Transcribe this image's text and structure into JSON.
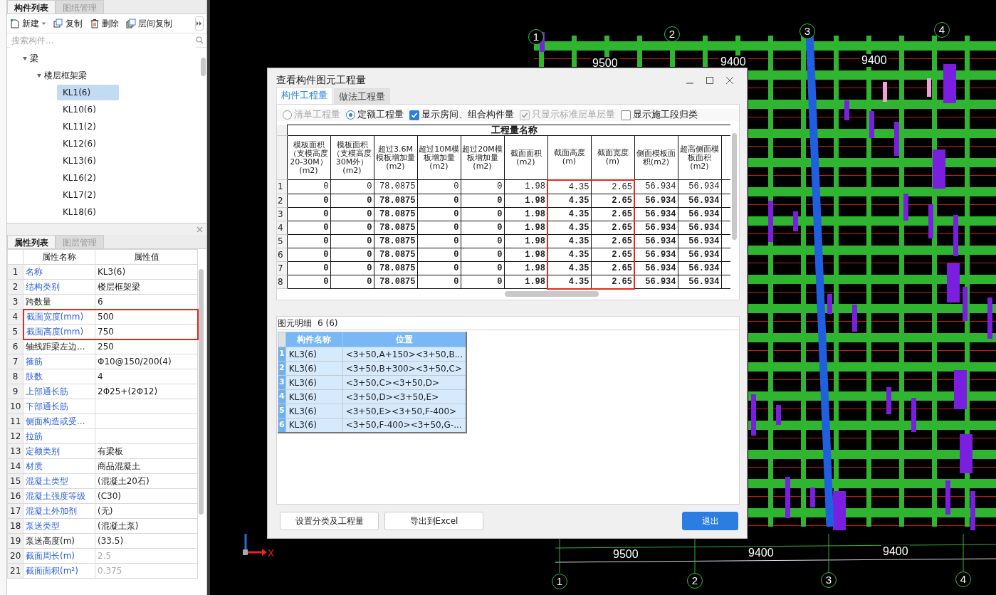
{
  "left_panel": {
    "tabs": [
      {
        "label": "构件列表",
        "selected": true
      },
      {
        "label": "图纸管理",
        "selected": false
      }
    ],
    "toolbar": [
      {
        "kind": "new",
        "label": "新建",
        "has_menu": true
      },
      {
        "kind": "copy",
        "label": "复制",
        "has_menu": false
      },
      {
        "kind": "delete",
        "label": "删除",
        "has_menu": false
      },
      {
        "kind": "floor_copy",
        "label": "层间复制",
        "has_menu": false
      }
    ],
    "search": {
      "placeholder": "搜索构件..."
    },
    "tree": [
      {
        "label": "梁",
        "expanded": true,
        "children": [
          {
            "label": "楼层框架梁",
            "expanded": true,
            "children": [
              {
                "label": "KL1(6)",
                "selected": true
              },
              {
                "label": "KL10(6)",
                "selected": false
              },
              {
                "label": "KL11(2)",
                "selected": false
              },
              {
                "label": "KL12(6)",
                "selected": false
              },
              {
                "label": "KL13(6)",
                "selected": false
              },
              {
                "label": "KL16(2)",
                "selected": false
              },
              {
                "label": "KL17(2)",
                "selected": false
              },
              {
                "label": "KL18(6)",
                "selected": false
              }
            ]
          }
        ]
      }
    ]
  },
  "properties": {
    "tabs": [
      {
        "label": "属性列表",
        "selected": true
      },
      {
        "label": "图层管理",
        "selected": false
      }
    ],
    "columns": [
      "属性名称",
      "属性值"
    ],
    "rows": [
      {
        "number": "1",
        "name": "名称",
        "value": "KL3(6)",
        "linked": true,
        "greyed": false,
        "highlighted": false
      },
      {
        "number": "2",
        "name": "结构类别",
        "value": "楼层框架梁",
        "linked": true,
        "greyed": false,
        "highlighted": false
      },
      {
        "number": "3",
        "name": "跨数量",
        "value": "6",
        "linked": false,
        "greyed": false,
        "highlighted": false
      },
      {
        "number": "4",
        "name": "截面宽度(mm)",
        "value": "500",
        "linked": true,
        "greyed": false,
        "highlighted": true
      },
      {
        "number": "5",
        "name": "截面高度(mm)",
        "value": "750",
        "linked": true,
        "greyed": false,
        "highlighted": true
      },
      {
        "number": "6",
        "name": "轴线距梁左边...",
        "value": "250",
        "linked": false,
        "greyed": false,
        "highlighted": false
      },
      {
        "number": "7",
        "name": "箍筋",
        "value": "Φ10@150/200(4)",
        "linked": true,
        "greyed": false,
        "highlighted": false
      },
      {
        "number": "8",
        "name": "肢数",
        "value": "4",
        "linked": true,
        "greyed": false,
        "highlighted": false
      },
      {
        "number": "9",
        "name": "上部通长筋",
        "value": "2Φ25+(2Φ12)",
        "linked": true,
        "greyed": false,
        "highlighted": false
      },
      {
        "number": "10",
        "name": "下部通长筋",
        "linked": true,
        "greyed": false,
        "highlighted": false
      },
      {
        "number": "11",
        "name": "侧面构造或受...",
        "linked": true,
        "greyed": false,
        "highlighted": false
      },
      {
        "number": "12",
        "name": "拉筋",
        "linked": true,
        "greyed": false,
        "highlighted": false
      },
      {
        "number": "13",
        "name": "定额类别",
        "value": "有梁板",
        "linked": true,
        "greyed": false,
        "highlighted": false
      },
      {
        "number": "14",
        "name": "材质",
        "value": "商品混凝土",
        "linked": true,
        "greyed": false,
        "highlighted": false
      },
      {
        "number": "15",
        "name": "混凝土类型",
        "value": "(混凝土20石)",
        "linked": true,
        "greyed": false,
        "highlighted": false
      },
      {
        "number": "16",
        "name": "混凝土强度等级",
        "value": "(C30)",
        "linked": true,
        "greyed": false,
        "highlighted": false
      },
      {
        "number": "17",
        "name": "混凝土外加剂",
        "value": "(无)",
        "linked": true,
        "greyed": false,
        "highlighted": false
      },
      {
        "number": "18",
        "name": "泵送类型",
        "value": "(混凝土泵)",
        "linked": true,
        "greyed": false,
        "highlighted": false
      },
      {
        "number": "19",
        "name": "泵送高度(m)",
        "value": "(33.5)",
        "linked": false,
        "greyed": false,
        "highlighted": false
      },
      {
        "number": "20",
        "name": "截面周长(m)",
        "value": "2.5",
        "linked": true,
        "greyed": true,
        "highlighted": false
      },
      {
        "number": "21",
        "name": "截面面积(m²)",
        "value": "0.375",
        "linked": true,
        "greyed": true,
        "highlighted": false
      }
    ]
  },
  "dialog": {
    "title": "查看构件图元工程量",
    "tabs": [
      {
        "label": "构件工程量",
        "selected": true
      },
      {
        "label": "做法工程量",
        "selected": false
      }
    ],
    "options": [
      {
        "kind": "radio",
        "label": "清单工程量",
        "checked": false,
        "disabled": true
      },
      {
        "kind": "radio",
        "label": "定额工程量",
        "checked": true,
        "disabled": false
      },
      {
        "kind": "checkbox",
        "label": "显示房间、组合构件量",
        "checked": true,
        "disabled": false
      },
      {
        "kind": "checkbox",
        "label": "只显示标准层单层量",
        "checked": true,
        "disabled": true
      },
      {
        "kind": "checkbox",
        "label": "显示施工段归类",
        "checked": false,
        "disabled": false
      }
    ],
    "table": {
      "group_header": "工程量名称",
      "columns": [
        {
          "label": "模板面积（支模高度20-30M）(m2)",
          "highlighted": false
        },
        {
          "label": "模板面积（支模高度30M外）(m2)",
          "highlighted": false
        },
        {
          "label": "超过3.6M模板增加量(m2)",
          "highlighted": false
        },
        {
          "label": "超过10M模板增加量(m2)",
          "highlighted": false
        },
        {
          "label": "超过20M模板增加量(m2)",
          "highlighted": false
        },
        {
          "label": "截面面积(m2)",
          "highlighted": false
        },
        {
          "label": "截面高度(m)",
          "highlighted": true
        },
        {
          "label": "截面宽度(m)",
          "highlighted": true
        },
        {
          "label": "侧面模板面积(m2)",
          "highlighted": false
        },
        {
          "label": "超高侧面模板面积(m2)",
          "highlighted": false
        }
      ],
      "rows": [
        {
          "number": "1",
          "bold": false,
          "cells": [
            "0",
            "0",
            "78.0875",
            "0",
            "0",
            "1.98",
            "4.35",
            "2.65",
            "56.934",
            "56.934"
          ]
        },
        {
          "number": "2",
          "bold": true,
          "cells": [
            "0",
            "0",
            "78.0875",
            "0",
            "0",
            "1.98",
            "4.35",
            "2.65",
            "56.934",
            "56.934"
          ]
        },
        {
          "number": "3",
          "bold": true,
          "cells": [
            "0",
            "0",
            "78.0875",
            "0",
            "0",
            "1.98",
            "4.35",
            "2.65",
            "56.934",
            "56.934"
          ]
        },
        {
          "number": "4",
          "bold": true,
          "cells": [
            "0",
            "0",
            "78.0875",
            "0",
            "0",
            "1.98",
            "4.35",
            "2.65",
            "56.934",
            "56.934"
          ]
        },
        {
          "number": "5",
          "bold": true,
          "cells": [
            "0",
            "0",
            "78.0875",
            "0",
            "0",
            "1.98",
            "4.35",
            "2.65",
            "56.934",
            "56.934"
          ]
        },
        {
          "number": "6",
          "bold": true,
          "cells": [
            "0",
            "0",
            "78.0875",
            "0",
            "0",
            "1.98",
            "4.35",
            "2.65",
            "56.934",
            "56.934"
          ]
        },
        {
          "number": "7",
          "bold": true,
          "cells": [
            "0",
            "0",
            "78.0875",
            "0",
            "0",
            "1.98",
            "4.35",
            "2.65",
            "56.934",
            "56.934"
          ]
        },
        {
          "number": "8",
          "bold": true,
          "cells": [
            "0",
            "0",
            "78.0875",
            "0",
            "0",
            "1.98",
            "4.35",
            "2.65",
            "56.934",
            "56.934"
          ]
        }
      ]
    },
    "detail": {
      "label": "图元明细",
      "count": "6 (6)",
      "columns": [
        "构件名称",
        "位置"
      ],
      "rows": [
        {
          "number": "1",
          "name": "KL3(6)",
          "position": "<3+50,A+150><3+50,B...",
          "selected": true
        },
        {
          "number": "2",
          "name": "KL3(6)",
          "position": "<3+50,B+300><3+50,C>",
          "selected": true
        },
        {
          "number": "3",
          "name": "KL3(6)",
          "position": "<3+50,C><3+50,D>",
          "selected": true
        },
        {
          "number": "4",
          "name": "KL3(6)",
          "position": "<3+50,D><3+50,E>",
          "selected": true
        },
        {
          "number": "5",
          "name": "KL3(6)",
          "position": "<3+50,E><3+50,F-400>",
          "selected": true
        },
        {
          "number": "6",
          "name": "KL3(6)",
          "position": "<3+50,F-400><3+50,G-...",
          "selected": true
        }
      ]
    },
    "buttons": [
      {
        "label": "设置分类及工程量",
        "primary": false
      },
      {
        "label": "导出到Excel",
        "primary": false
      },
      {
        "label": "退出",
        "primary": true
      }
    ]
  },
  "cad": {
    "top_axes": [
      "1",
      "2",
      "3",
      "4"
    ],
    "top_dimensions": [
      "9500",
      "9400",
      "9400"
    ],
    "bottom_dimensions": [
      "9500",
      "9400",
      "9400"
    ],
    "bottom_axes": [
      "1",
      "2",
      "3",
      "4"
    ],
    "axis_label": "X"
  }
}
